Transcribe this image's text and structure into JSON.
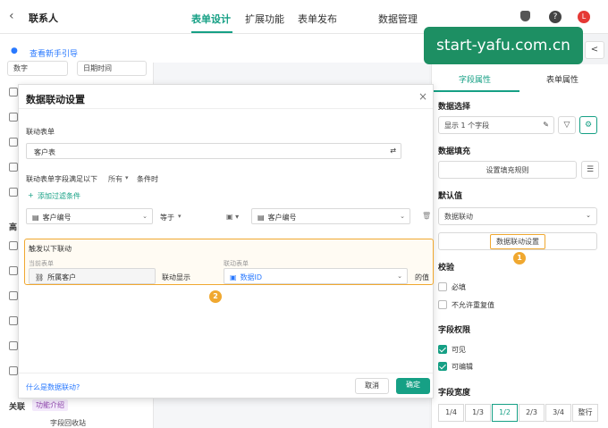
{
  "header": {
    "back_icon": "chevron-left-icon",
    "title": "联系人",
    "tabs": [
      "表单设计",
      "扩展功能",
      "表单发布",
      "数据管理"
    ],
    "active_tab": "表单设计",
    "avatar_letter": "L",
    "help_badge": "48"
  },
  "guide": {
    "text": "查看新手引导"
  },
  "left_panel": {
    "chips": [
      "数字",
      "日期时间"
    ],
    "section_labels": [
      "高",
      "关联"
    ],
    "feature_intro": "功能介绍",
    "recycle": "字段回收站"
  },
  "watermark": "start-yafu.com.cn",
  "right_panel": {
    "tabs": [
      "字段属性",
      "表单属性"
    ],
    "data_select_label": "数据选择",
    "data_select_value": "显示 1 个字段",
    "data_fill_label": "数据填充",
    "fill_rule_button": "设置填充规则",
    "default_label": "默认值",
    "default_value": "数据联动",
    "link_setting_button": "数据联动设置",
    "validate_label": "校验",
    "required": "必填",
    "no_duplicate": "不允许重复值",
    "perm_label": "字段权限",
    "visible": "可见",
    "editable": "可编辑",
    "width_label": "字段宽度",
    "widths": [
      "1/4",
      "1/3",
      "1/2",
      "2/3",
      "3/4",
      "整行"
    ],
    "active_width": "1/2",
    "badge_1": "1"
  },
  "modal": {
    "title": "数据联动设置",
    "link_form_label": "联动表单",
    "link_form_value": "客户表",
    "condition_prefix": "联动表单字段满足以下",
    "condition_mode": "所有",
    "condition_suffix": "条件时",
    "add_filter": "添加过滤条件",
    "filter_field": "客户编号",
    "filter_op": "等于",
    "filter_value_field": "客户编号",
    "trigger_label": "触发以下联动",
    "current_form_col": "当前表单",
    "link_form_col": "联动表单",
    "current_field": "所属客户",
    "link_display": "联动显示",
    "target_field": "数据ID",
    "value_suffix": "的值",
    "badge_2": "2",
    "help_link": "什么是数据联动?",
    "cancel": "取消",
    "confirm": "确定"
  },
  "colors": {
    "accent": "#16a085",
    "highlight": "#f0a830",
    "link": "#2979ff"
  }
}
